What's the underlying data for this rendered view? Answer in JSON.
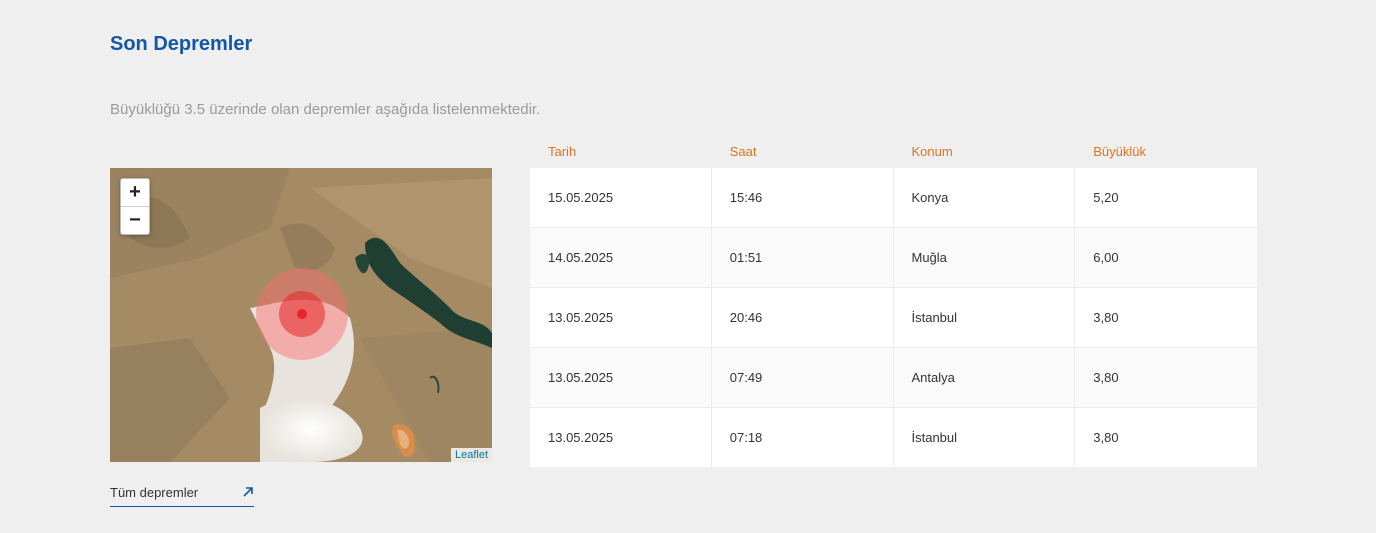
{
  "header": {
    "title": "Son Depremler",
    "subtitle": "Büyüklüğü 3.5 üzerinde olan depremler aşağıda listelenmektedir."
  },
  "map": {
    "zoom_in_label": "+",
    "zoom_out_label": "−",
    "attribution": "Leaflet",
    "marker_color": "#e8262a"
  },
  "link": {
    "label": "Tüm depremler",
    "icon": "arrow-up-right-icon"
  },
  "table": {
    "headers": [
      "Tarih",
      "Saat",
      "Konum",
      "Büyüklük"
    ],
    "rows": [
      [
        "15.05.2025",
        "15:46",
        "Konya",
        "5,20"
      ],
      [
        "14.05.2025",
        "01:51",
        "Muğla",
        "6,00"
      ],
      [
        "13.05.2025",
        "20:46",
        "İstanbul",
        "3,80"
      ],
      [
        "13.05.2025",
        "07:49",
        "Antalya",
        "3,80"
      ],
      [
        "13.05.2025",
        "07:18",
        "İstanbul",
        "3,80"
      ]
    ]
  },
  "colors": {
    "title": "#1357a6",
    "header_accent": "#e0731e",
    "background": "#efefef"
  }
}
